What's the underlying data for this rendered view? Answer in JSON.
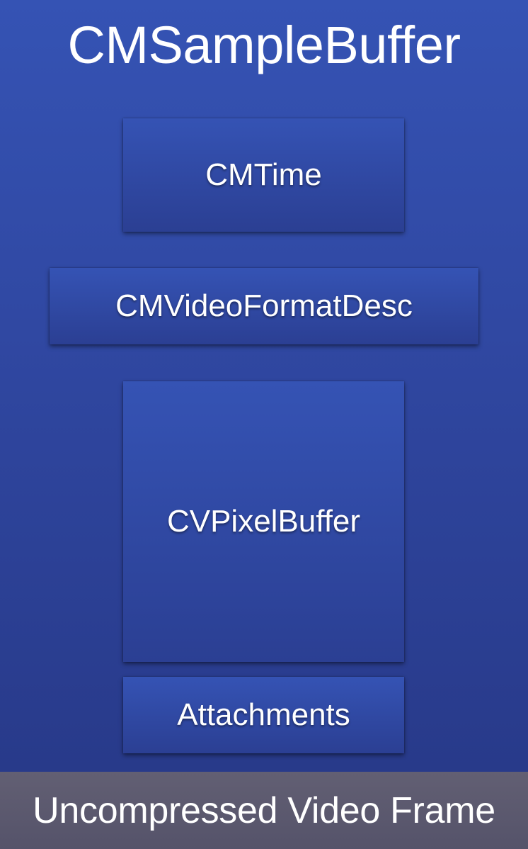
{
  "title": "CMSampleBuffer",
  "components": {
    "time": "CMTime",
    "format_desc": "CMVideoFormatDesc",
    "pixel_buffer": "CVPixelBuffer",
    "attachments": "Attachments"
  },
  "footer": "Uncompressed Video Frame",
  "colors": {
    "container_top": "#3553b4",
    "container_bottom": "#283a8a",
    "footer_bg": "#5a586d",
    "text": "#ffffff"
  }
}
